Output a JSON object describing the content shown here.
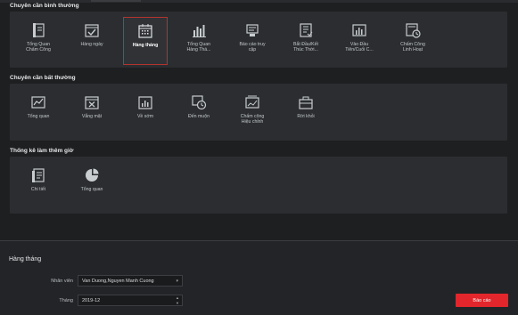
{
  "colors": {
    "accent": "#e2262b",
    "selected_border": "#b3342e",
    "panel": "#2b2d30",
    "background": "#1e1f21"
  },
  "sections": {
    "normal": {
      "title": "Chuyên cần bình thường",
      "items": [
        {
          "label": "Tổng Quan\nChấm Công",
          "icon": "overview-card-icon"
        },
        {
          "label": "Hàng ngày",
          "icon": "daily-check-icon"
        },
        {
          "label": "Hàng tháng",
          "icon": "monthly-calendar-icon",
          "selected": true
        },
        {
          "label": "Tổng Quan\nHàng Thá...",
          "icon": "bar-chart-icon"
        },
        {
          "label": "Báo cáo truy\ncập",
          "icon": "access-report-icon"
        },
        {
          "label": "Bắt Đầu/Kết\nThúc Thời...",
          "icon": "start-end-time-icon"
        },
        {
          "label": "Vào Đầu\nTiên/Cuối C...",
          "icon": "first-last-chart-icon"
        },
        {
          "label": "Chấm Công\nLinh Hoạt",
          "icon": "flexible-time-icon"
        }
      ]
    },
    "abnormal": {
      "title": "Chuyên cần bất thường",
      "items": [
        {
          "label": "Tổng quan",
          "icon": "abnormal-overview-icon"
        },
        {
          "label": "Vắng mặt",
          "icon": "absence-icon"
        },
        {
          "label": "Về sớm",
          "icon": "early-leave-icon"
        },
        {
          "label": "Đến muộn",
          "icon": "late-clock-icon"
        },
        {
          "label": "Chấm công\nHiệu chỉnh",
          "icon": "correction-icon"
        },
        {
          "label": "Rời khỏi",
          "icon": "leave-briefcase-icon"
        }
      ]
    },
    "overtime": {
      "title": "Thống kê làm thêm giờ",
      "items": [
        {
          "label": "Chi tiết",
          "icon": "detail-document-icon"
        },
        {
          "label": "Tổng quan",
          "icon": "pie-chart-icon"
        }
      ]
    }
  },
  "form": {
    "title": "Hàng tháng",
    "employee_label": "Nhân viên",
    "employee_value": "Van Duong,Nguyen Manh Cuong",
    "month_label": "Tháng",
    "month_value": "2019-12"
  },
  "report_button": "Báo cáo"
}
